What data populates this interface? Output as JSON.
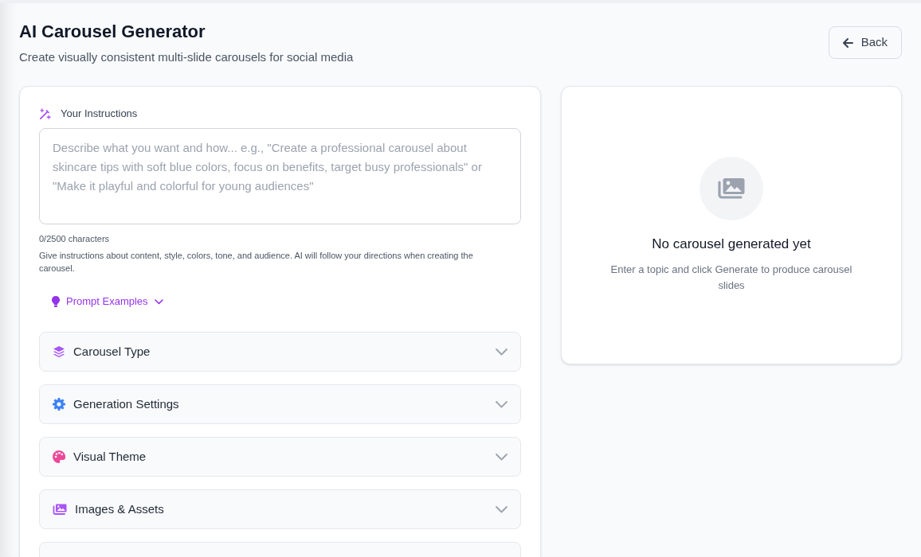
{
  "header": {
    "title": "AI Carousel Generator",
    "subtitle": "Create visually consistent multi-slide carousels for social media",
    "back_button": "Back"
  },
  "instructions": {
    "label": "Your Instructions",
    "placeholder": "Describe what you want and how... e.g., \"Create a professional carousel about skincare tips with soft blue colors, focus on benefits, target busy professionals\" or \"Make it playful and colorful for young audiences\"",
    "char_count": "0/2500 characters",
    "help": "Give instructions about content, style, colors, tone, and audience. AI will follow your directions when creating the carousel."
  },
  "prompt_examples": {
    "label": "Prompt Examples",
    "expanded": false
  },
  "sections": [
    {
      "kind": "layers",
      "title": "Carousel Type",
      "color": "#a855f7",
      "expanded": false
    },
    {
      "kind": "gear",
      "title": "Generation Settings",
      "color": "#3b82f6",
      "expanded": false
    },
    {
      "kind": "palette",
      "title": "Visual Theme",
      "color": "#ec4899",
      "expanded": false
    },
    {
      "kind": "images",
      "title": "Images & Assets",
      "color": "#a855f7",
      "expanded": false
    },
    {
      "kind": "unknown"
    }
  ],
  "preview": {
    "title": "No carousel generated yet",
    "message": "Enter a topic and click Generate to produce carousel slides"
  }
}
